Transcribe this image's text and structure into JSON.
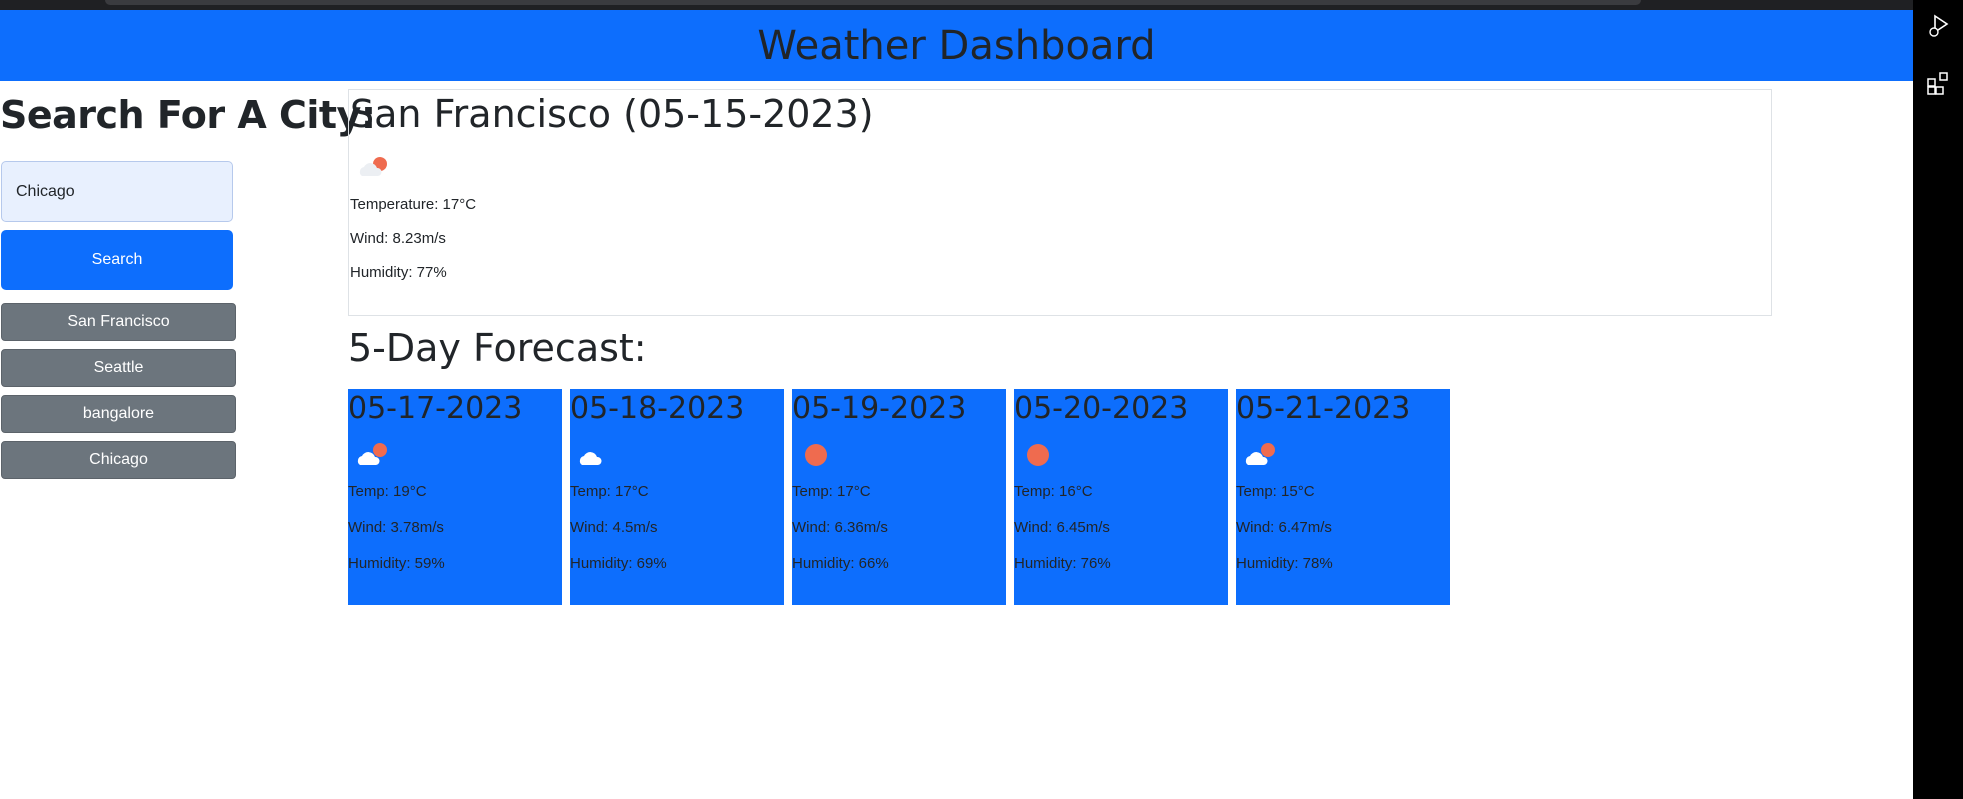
{
  "header": {
    "title": "Weather Dashboard"
  },
  "sidebar": {
    "heading": "Search For A City:",
    "search_value": "Chicago",
    "search_button": "Search",
    "history": [
      "San Francisco",
      "Seattle",
      "bangalore",
      "Chicago"
    ]
  },
  "current": {
    "title": "San Francisco (05-15-2023)",
    "icon": "partly-cloudy-icon",
    "temperature": "Temperature: 17°C",
    "wind": "Wind: 8.23m/s",
    "humidity": "Humidity: 77%"
  },
  "forecast": {
    "title": "5-Day Forecast:",
    "days": [
      {
        "date": "05-17-2023",
        "icon": "partly-cloudy-icon",
        "temp": "Temp: 19°C",
        "wind": "Wind: 3.78m/s",
        "humidity": "Humidity: 59%"
      },
      {
        "date": "05-18-2023",
        "icon": "cloud-icon",
        "temp": "Temp: 17°C",
        "wind": "Wind: 4.5m/s",
        "humidity": "Humidity: 69%"
      },
      {
        "date": "05-19-2023",
        "icon": "sun-icon",
        "temp": "Temp: 17°C",
        "wind": "Wind: 6.36m/s",
        "humidity": "Humidity: 66%"
      },
      {
        "date": "05-20-2023",
        "icon": "sun-icon",
        "temp": "Temp: 16°C",
        "wind": "Wind: 6.45m/s",
        "humidity": "Humidity: 76%"
      },
      {
        "date": "05-21-2023",
        "icon": "partly-cloudy-icon",
        "temp": "Temp: 15°C",
        "wind": "Wind: 6.47m/s",
        "humidity": "Humidity: 78%"
      }
    ]
  },
  "colors": {
    "primary": "#0d6efd",
    "secondary": "#6c757d",
    "sun": "#ef6b4f"
  }
}
